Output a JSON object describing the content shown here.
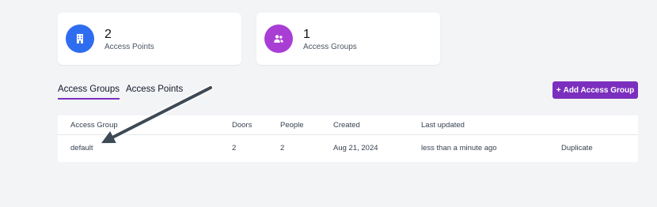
{
  "stats": [
    {
      "value": "2",
      "label": "Access Points",
      "icon": "building-icon",
      "color": "#2f6df0"
    },
    {
      "value": "1",
      "label": "Access Groups",
      "icon": "users-icon",
      "color": "#a93ed4"
    }
  ],
  "tabs": [
    {
      "label": "Access Groups",
      "active": true
    },
    {
      "label": "Access Points",
      "active": false
    }
  ],
  "add_button": {
    "icon": "+",
    "label": "Add Access Group",
    "color": "#7b2fbe"
  },
  "table": {
    "columns": [
      "Access Group",
      "Doors",
      "People",
      "Created",
      "Last updated"
    ],
    "rows": [
      {
        "name": "default",
        "doors": "2",
        "people": "2",
        "created": "Aug 21, 2024",
        "updated": "less than a minute ago",
        "action": "Duplicate"
      }
    ]
  }
}
